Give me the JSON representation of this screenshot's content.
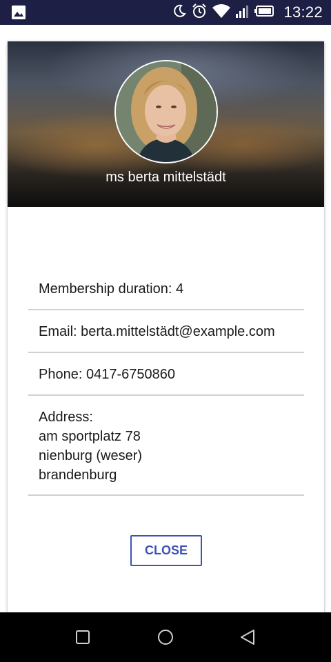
{
  "status_bar": {
    "time": "13:22",
    "icons": [
      "gallery-icon",
      "moon-icon",
      "alarm-icon",
      "wifi-icon",
      "signal-icon",
      "battery-icon"
    ],
    "color": "#1d2044"
  },
  "profile": {
    "name": "ms berta mittelstädt",
    "membership": "Membership duration: 4",
    "email": "Email: berta.mittelstädt@example.com",
    "phone": "Phone: 0417-6750860",
    "address_label": "Address:",
    "address_street": "am sportplatz 78",
    "address_city": "nienburg (weser)",
    "address_state": "brandenburg"
  },
  "actions": {
    "close_label": "CLOSE",
    "accent": "#3f51b5"
  },
  "nav_bar": {
    "icons": [
      "square-icon",
      "circle-icon",
      "triangle-back-icon"
    ]
  }
}
